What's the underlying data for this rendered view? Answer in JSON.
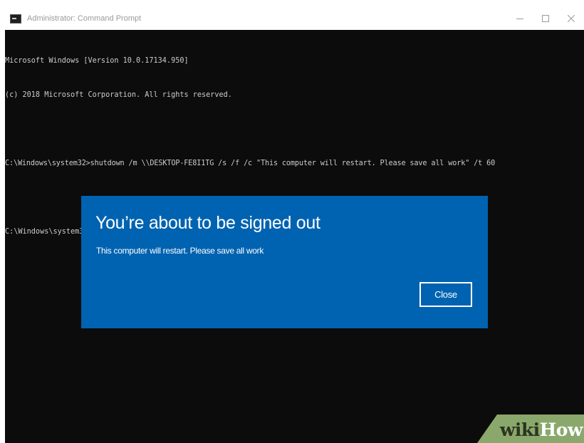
{
  "window": {
    "title": "Administrator: Command Prompt",
    "icon": "cmd-icon",
    "controls": {
      "minimize_icon": "minimize-icon",
      "maximize_icon": "maximize-icon",
      "close_icon": "close-icon"
    }
  },
  "console": {
    "lines": [
      "Microsoft Windows [Version 10.0.17134.950]",
      "(c) 2018 Microsoft Corporation. All rights reserved.",
      "",
      "C:\\Windows\\system32>shutdown /m \\\\DESKTOP-FE8I1TG /s /f /c \"This computer will restart. Please save all work\" /t 60",
      "",
      "C:\\Windows\\system32>"
    ],
    "text_color": "#cccccc",
    "background": "#0c0c0c"
  },
  "dialog": {
    "title": "You’re about to be signed out",
    "message": "This computer will restart. Please save all work",
    "close_label": "Close",
    "background": "#0063b1"
  },
  "watermark": {
    "wiki": "wiki",
    "how": "How",
    "color": "#8aa86b"
  }
}
